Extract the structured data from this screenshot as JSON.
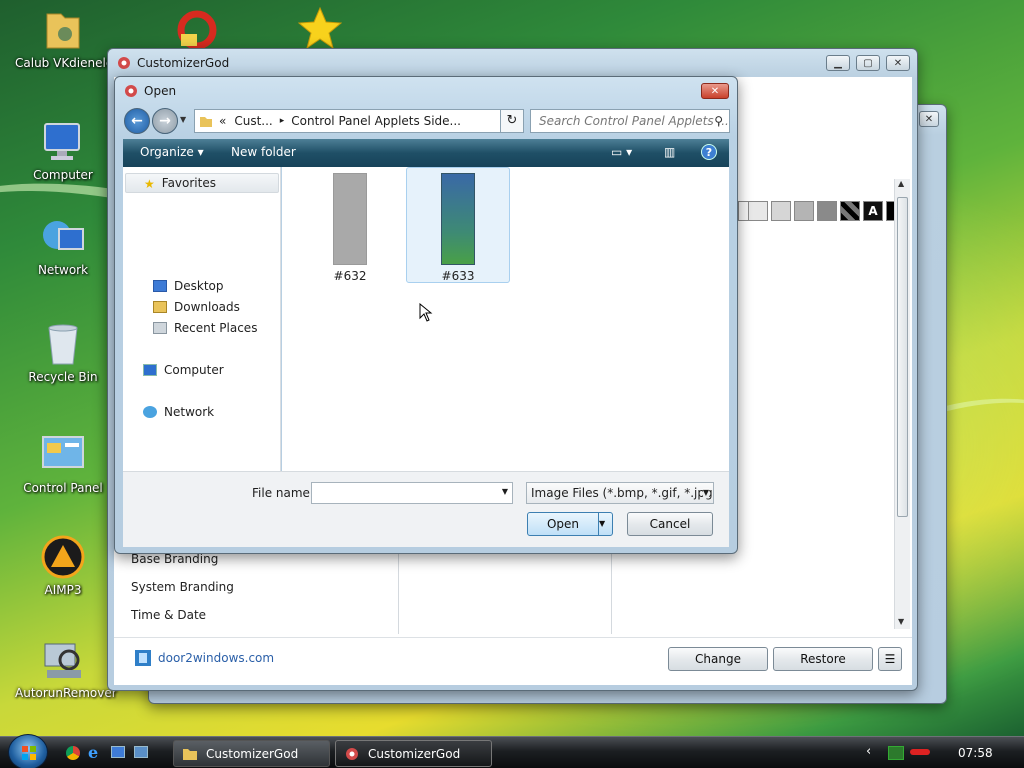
{
  "desktop": {
    "icons": [
      {
        "label": "Calub VKdienele"
      },
      {
        "label": "Computer"
      },
      {
        "label": "Network"
      },
      {
        "label": "Recycle Bin"
      },
      {
        "label": "Control Panel"
      },
      {
        "label": "AIMP3"
      },
      {
        "label": "AutorunRemover"
      }
    ]
  },
  "main_window": {
    "title": "CustomizerGod",
    "list_items": [
      "Base Branding",
      "System Branding",
      "Time & Date"
    ],
    "link": "door2windows.com",
    "buttons": {
      "change": "Change",
      "restore": "Restore",
      "menu": "☰"
    }
  },
  "open_dialog": {
    "title": "Open",
    "breadcrumb": {
      "root": "«",
      "part1": "Cust...",
      "sep": "▸",
      "part2": "Control Panel Applets Side..."
    },
    "search_placeholder": "Search Control Panel Applets ...",
    "commands": {
      "organize": "Organize ▾",
      "new_folder": "New folder"
    },
    "nav": {
      "favorites": "Favorites",
      "desktop": "Desktop",
      "downloads": "Downloads",
      "recent": "Recent Places",
      "computer": "Computer",
      "network": "Network"
    },
    "files": [
      {
        "name": "#632",
        "color": "#a9a9a9"
      },
      {
        "name": "#633",
        "color": "#3b6ea0"
      }
    ],
    "file_name_label": "File name:",
    "file_name_value": "",
    "filter": "Image Files (*.bmp, *.gif, *.jpg,",
    "open_button": "Open",
    "cancel_button": "Cancel"
  },
  "taskbar": {
    "tasks": [
      {
        "label": "CustomizerGod"
      },
      {
        "label": "CustomizerGod"
      }
    ],
    "clock": "07:58"
  }
}
